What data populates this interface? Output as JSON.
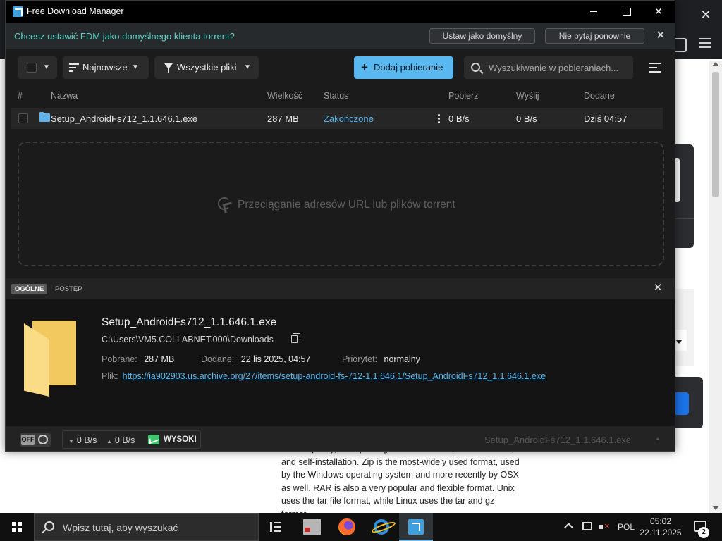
{
  "app": {
    "title": "Free Download Manager"
  },
  "notification": {
    "message": "Chcesz ustawić FDM jako domyślnego klienta torrent?",
    "set_default": "Ustaw jako domyślny",
    "dont_ask": "Nie pytaj ponownie"
  },
  "toolbar": {
    "sort_label": "Najnowsze",
    "filter_label": "Wszystkie pliki",
    "add_label": "Dodaj pobieranie",
    "search_placeholder": "Wyszukiwanie w pobieraniach..."
  },
  "table": {
    "columns": [
      "#",
      "Nazwa",
      "Wielkość",
      "Status",
      "Pobierz",
      "Wyślij",
      "Dodane"
    ],
    "rows": [
      {
        "name": "Setup_AndroidFs712_1.1.646.1.exe",
        "size": "287 MB",
        "status": "Zakończone",
        "download_speed": "0 B/s",
        "upload_speed": "0 B/s",
        "added": "Dziś 04:57"
      }
    ]
  },
  "dropzone": {
    "text": "Przeciąganie adresów URL lub plików torrent"
  },
  "details": {
    "tabs": [
      "OGÓLNE",
      "POSTĘP"
    ],
    "file_name": "Setup_AndroidFs712_1.1.646.1.exe",
    "path": "C:\\Users\\VM5.COLLABNET.000\\Downloads",
    "downloaded_label": "Pobrane:",
    "downloaded_value": "287 MB",
    "added_label": "Dodane:",
    "added_value": "22 lis 2025, 04:57",
    "priority_label": "Priorytet:",
    "priority_value": "normalny",
    "file_label": "Plik:",
    "url": "https://ia902903.us.archive.org/27/items/setup-android-fs-712-1.1.646.1/Setup_AndroidFs712_1.1.646.1.exe"
  },
  "statusbar": {
    "off_label": "OFF",
    "download_speed": "0 B/s",
    "upload_speed": "0 B/s",
    "mode": "WYSOKI",
    "current_file": "Setup_AndroidFs712_1.1.646.1.exe"
  },
  "background_article": {
    "text": "for everybody, no-repackage tranformations, self-extraction, and self-installation. Zip is the most-widely used format, used by the Windows operating system and more recently by OSX as well. RAR is also a very popular and flexible format. Unix uses the tar file format, while Linux uses the tar and gz format."
  },
  "taskbar": {
    "search_placeholder": "Wpisz tutaj, aby wyszukać",
    "language": "POL",
    "time": "05:02",
    "date": "22.11.2025",
    "notifications_count": "2"
  },
  "colors": {
    "accent": "#5ab8f0",
    "notification_text": "#5fd3c8",
    "high_mode": "#3ec46d"
  }
}
